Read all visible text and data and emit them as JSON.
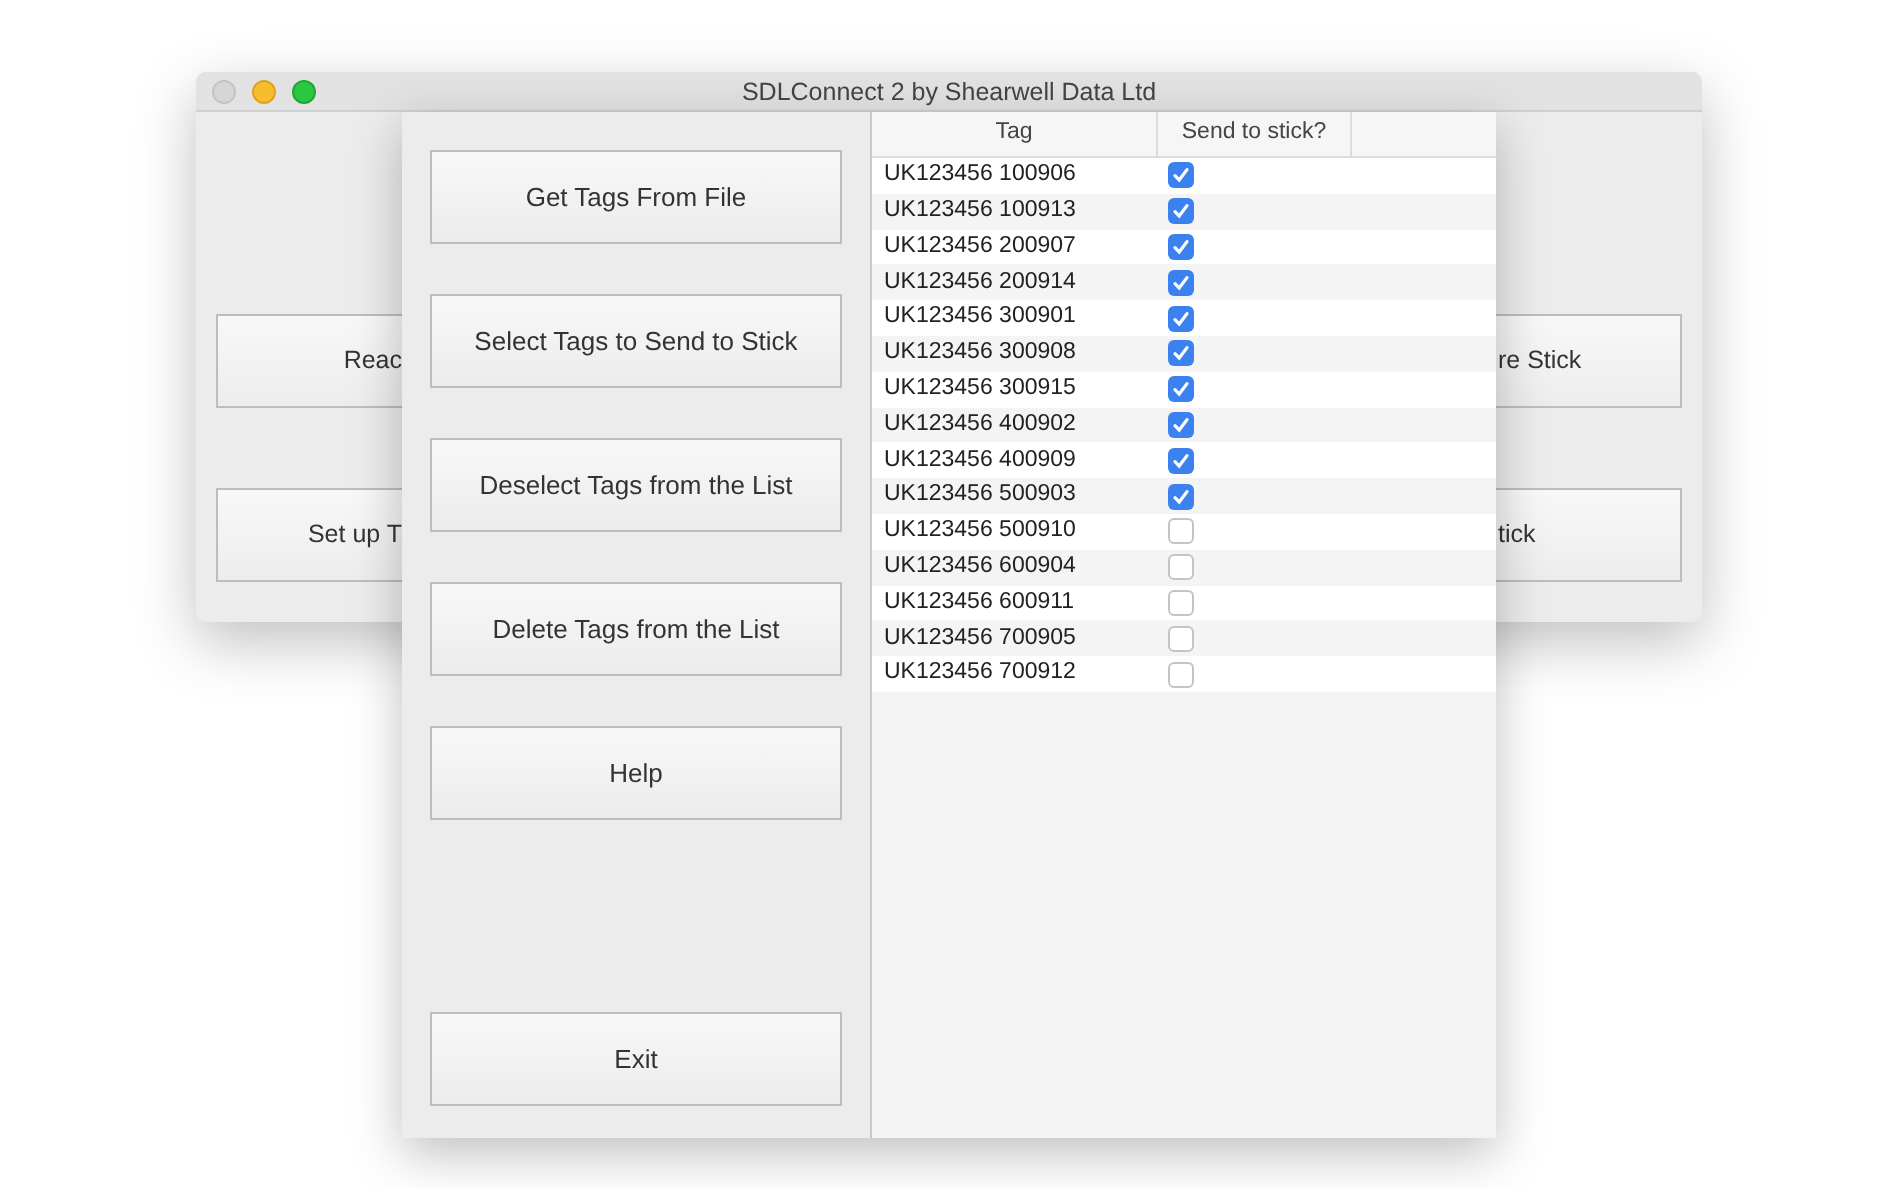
{
  "back_window": {
    "title": "SDLConnect 2 by Shearwell Data Ltd",
    "traffic_lights": [
      {
        "kind": "close",
        "color": "#d6d6d6"
      },
      {
        "kind": "minimize",
        "color": "#f6be2f"
      },
      {
        "kind": "zoom",
        "color": "#2ac840"
      }
    ],
    "left_buttons": [
      "Reac",
      "Set up T"
    ],
    "right_buttons": [
      "re Stick",
      "tick"
    ]
  },
  "front_window": {
    "buttons": [
      {
        "label": "Get Tags From File",
        "kind": "action"
      },
      {
        "label": "Select Tags to Send to Stick",
        "kind": "action"
      },
      {
        "label": "Deselect Tags from the List",
        "kind": "action"
      },
      {
        "label": "Delete Tags from the List",
        "kind": "action"
      },
      {
        "label": "Help",
        "kind": "action"
      },
      {
        "label": "Exit",
        "kind": "exit"
      }
    ],
    "table": {
      "columns": [
        "Tag",
        "Send to stick?"
      ],
      "rows": [
        {
          "tag": "UK123456 100906",
          "checked": true
        },
        {
          "tag": "UK123456 100913",
          "checked": true
        },
        {
          "tag": "UK123456 200907",
          "checked": true
        },
        {
          "tag": "UK123456 200914",
          "checked": true
        },
        {
          "tag": "UK123456 300901",
          "checked": true
        },
        {
          "tag": "UK123456 300908",
          "checked": true
        },
        {
          "tag": "UK123456 300915",
          "checked": true
        },
        {
          "tag": "UK123456 400902",
          "checked": true
        },
        {
          "tag": "UK123456 400909",
          "checked": true
        },
        {
          "tag": "UK123456 500903",
          "checked": true
        },
        {
          "tag": "UK123456 500910",
          "checked": false
        },
        {
          "tag": "UK123456 600904",
          "checked": false
        },
        {
          "tag": "UK123456 600911",
          "checked": false
        },
        {
          "tag": "UK123456 700905",
          "checked": false
        },
        {
          "tag": "UK123456 700912",
          "checked": false
        }
      ]
    }
  }
}
